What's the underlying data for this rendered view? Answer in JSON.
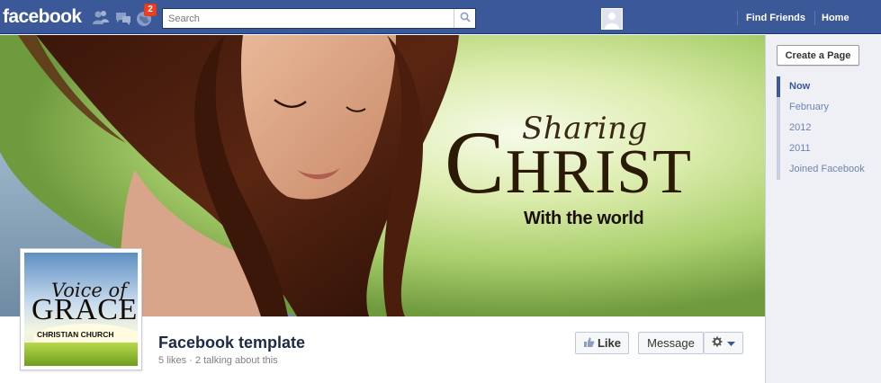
{
  "topbar": {
    "logo": "facebook",
    "notifications_count": "2",
    "search_placeholder": "Search",
    "find_friends": "Find Friends",
    "home": "Home",
    "icons": [
      "friend-requests-icon",
      "messages-icon",
      "notifications-globe-icon",
      "search-icon"
    ]
  },
  "cover": {
    "line1": "Sharing",
    "line2_first": "C",
    "line2_rest": "HRIST",
    "line3": "With the world"
  },
  "profile_picture": {
    "line1": "Voice of",
    "line2": "GRACE",
    "line3": "CHRISTIAN CHURCH"
  },
  "page": {
    "name": "Facebook template",
    "stats": "5 likes · 2 talking about this"
  },
  "actions": {
    "like": "Like",
    "message": "Message"
  },
  "rail": {
    "create_page": "Create a Page",
    "timeline": [
      "Now",
      "February",
      "2012",
      "2011",
      "Joined Facebook"
    ]
  },
  "colors": {
    "brand": "#3b5998",
    "badge": "#f03d25",
    "rail_bg": "#eef0f6"
  }
}
